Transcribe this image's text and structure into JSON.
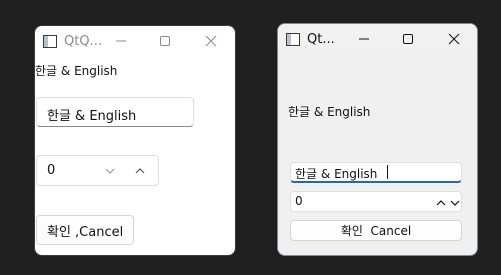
{
  "left_window": {
    "title": "QtQ...",
    "label_text": "한글 & English",
    "line_edit_value": "한글 & English",
    "spin_value": "0",
    "button_text": "확인 ,Cancel"
  },
  "right_window": {
    "title": "Qt...",
    "label_text": "한글 & English",
    "line_edit_value": "한글 & English",
    "spin_value": "0",
    "button_text": "확인  Cancel"
  }
}
